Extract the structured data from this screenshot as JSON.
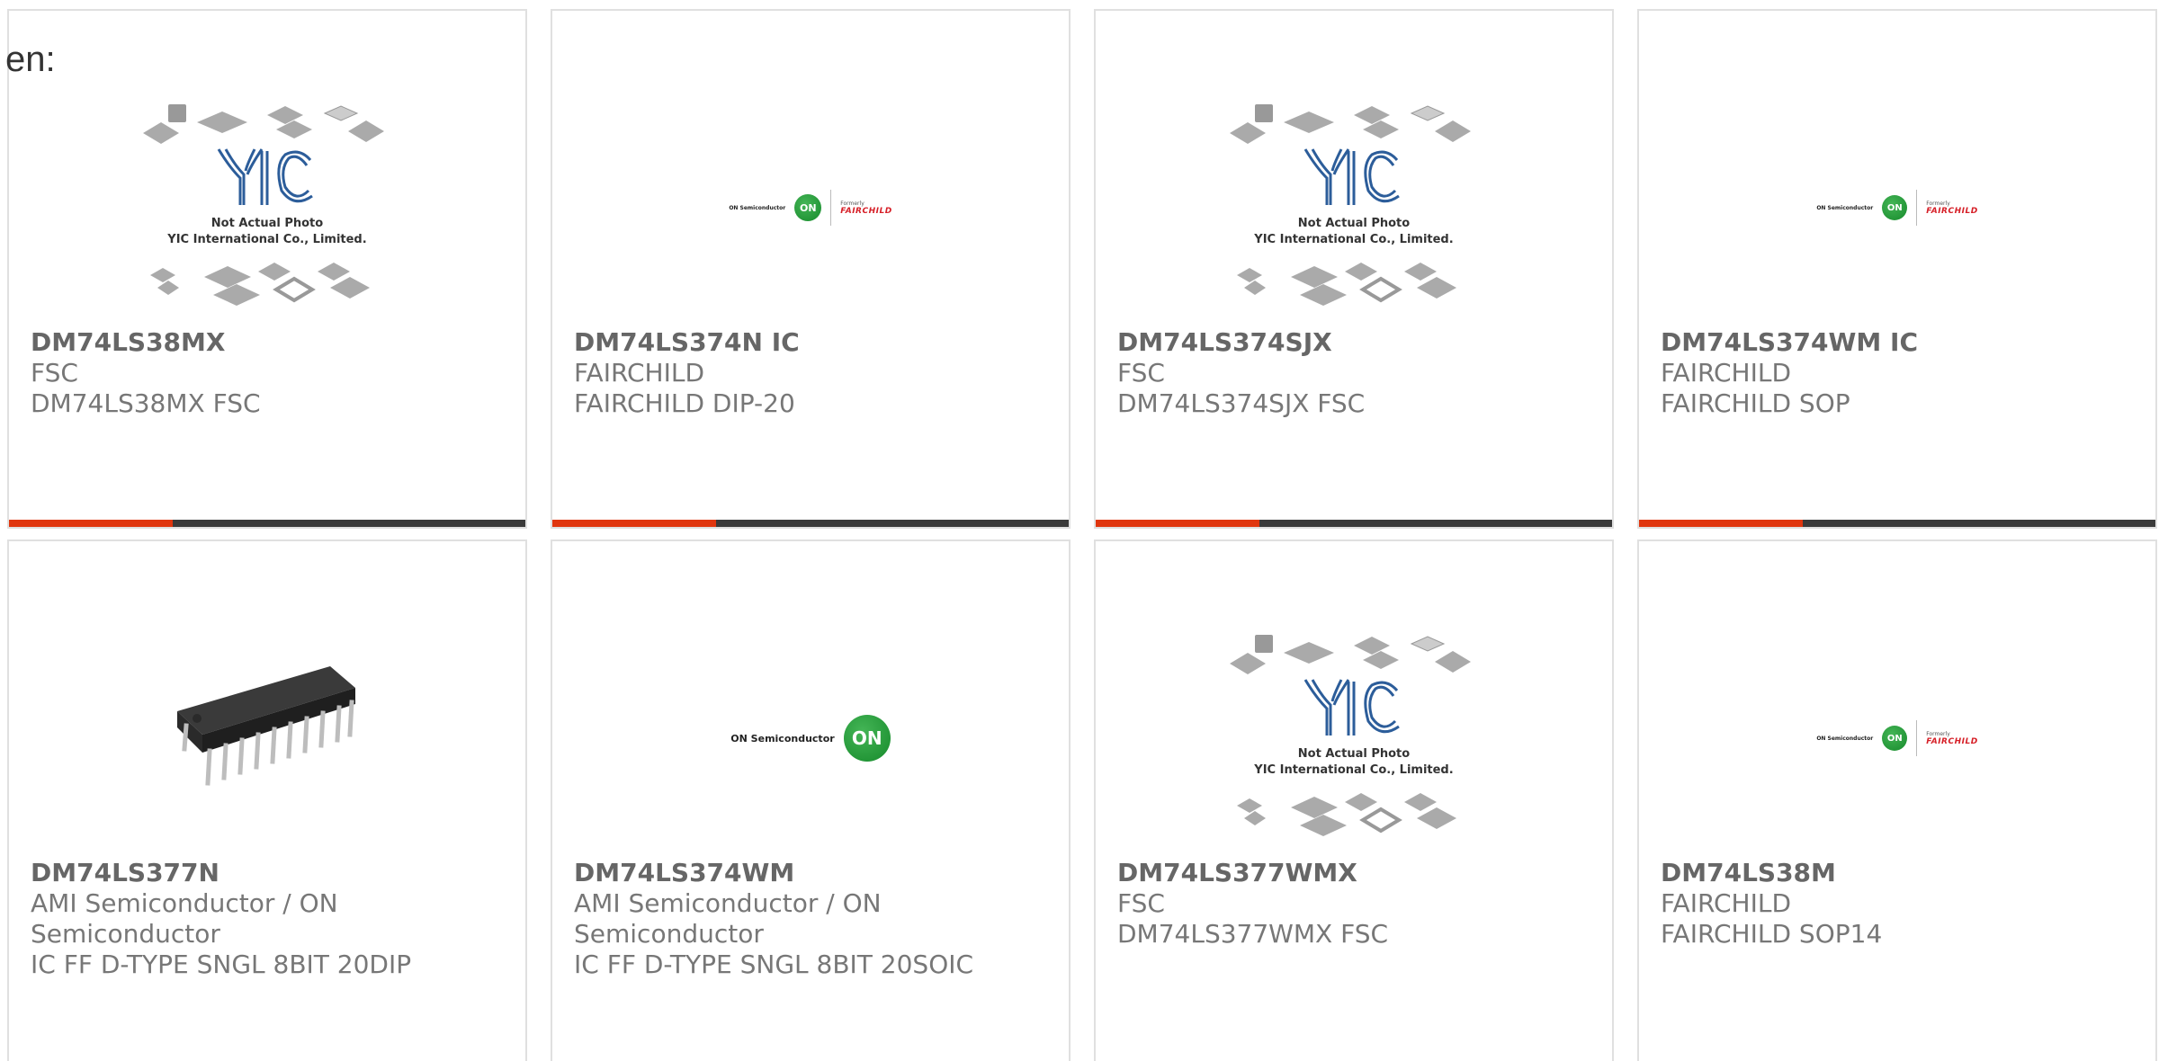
{
  "lang_label": "en:",
  "colors": {
    "accent_red": "#e0360f",
    "accent_dark": "#3a3a3a",
    "border": "#e0e0e0",
    "text": "#777777"
  },
  "placeholder_photo": {
    "line1": "Not Actual Photo",
    "line2": "YIC International Co., Limited."
  },
  "on_logo": {
    "brand_text": "ON Semiconductor",
    "circle_text": "ON",
    "formerly": "Formerly",
    "fairchild": "FAIRCHILD"
  },
  "products": [
    {
      "part": "DM74LS38MX",
      "manufacturer": "FSC",
      "description": "DM74LS38MX FSC",
      "image": "yic-placeholder"
    },
    {
      "part": "DM74LS374N IC",
      "manufacturer": "FAIRCHILD",
      "description": "FAIRCHILD DIP-20",
      "image": "on-fairchild-logo"
    },
    {
      "part": "DM74LS374SJX",
      "manufacturer": "FSC",
      "description": "DM74LS374SJX FSC",
      "image": "yic-placeholder"
    },
    {
      "part": "DM74LS374WM IC",
      "manufacturer": "FAIRCHILD",
      "description": "FAIRCHILD SOP",
      "image": "on-fairchild-logo"
    },
    {
      "part": "DM74LS377N",
      "manufacturer": "AMI Semiconductor / ON Semiconductor",
      "description": "IC FF D-TYPE SNGL 8BIT 20DIP",
      "image": "dip-chip-photo"
    },
    {
      "part": "DM74LS374WM",
      "manufacturer": "AMI Semiconductor / ON Semiconductor",
      "description": "IC FF D-TYPE SNGL 8BIT 20SOIC",
      "image": "on-semiconductor-logo"
    },
    {
      "part": "DM74LS377WMX",
      "manufacturer": "FSC",
      "description": "DM74LS377WMX FSC",
      "image": "yic-placeholder"
    },
    {
      "part": "DM74LS38M",
      "manufacturer": "FAIRCHILD",
      "description": "FAIRCHILD SOP14",
      "image": "on-fairchild-logo"
    }
  ]
}
